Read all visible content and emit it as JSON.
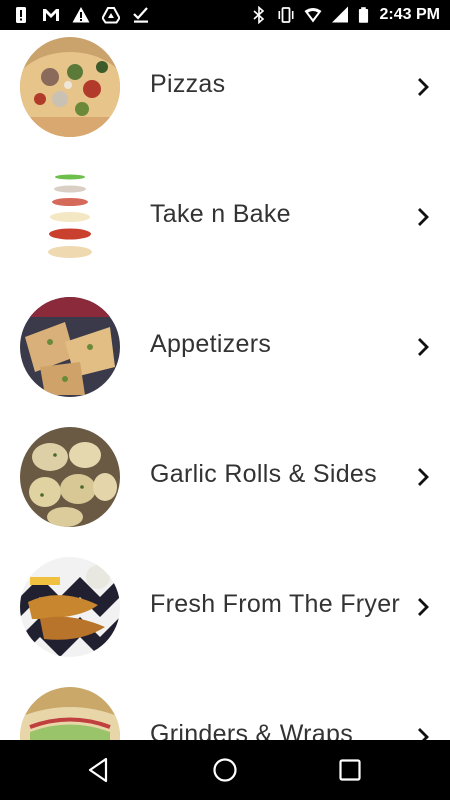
{
  "status_bar": {
    "time": "2:43 PM",
    "left_icons": [
      "alert-notification-icon",
      "gmail-icon",
      "warning-icon",
      "drive-icon",
      "download-done-icon"
    ],
    "right_icons": [
      "bluetooth-icon",
      "vibrate-icon",
      "wifi-icon",
      "signal-icon",
      "battery-icon"
    ]
  },
  "menu": {
    "items": [
      {
        "label": "Pizzas",
        "image": "pizza-photo"
      },
      {
        "label": "Take n Bake",
        "image": "take-n-bake-layers-photo"
      },
      {
        "label": "Appetizers",
        "image": "appetizers-photo"
      },
      {
        "label": "Garlic Rolls & Sides",
        "image": "garlic-rolls-photo"
      },
      {
        "label": "Fresh From The Fryer",
        "image": "fried-fish-photo"
      },
      {
        "label": "Grinders & Wraps",
        "image": "grinders-wraps-photo"
      }
    ]
  },
  "nav_bar": {
    "buttons": [
      "back-icon",
      "home-icon",
      "recents-icon"
    ]
  }
}
